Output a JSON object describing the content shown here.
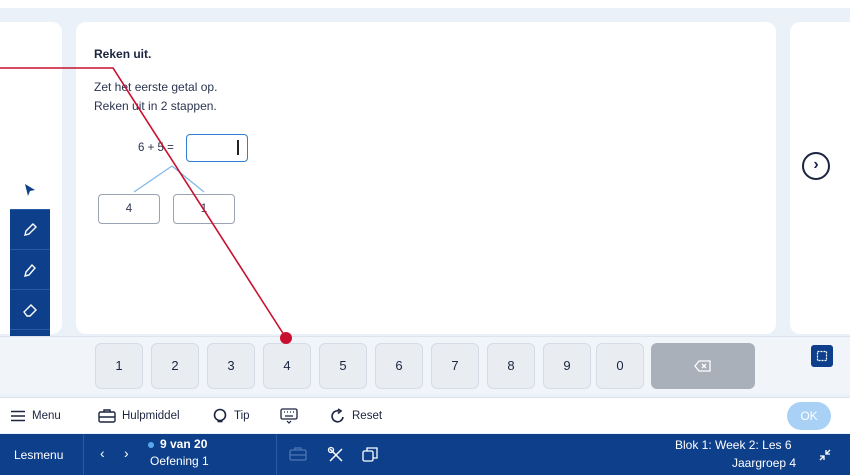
{
  "exercise": {
    "title": "Reken uit.",
    "instruction_1": "Zet het eerste getal op.",
    "instruction_2": "Reken uit in 2 stappen.",
    "expression": "6 + 5 =",
    "answer_value": "",
    "split_left": "4",
    "split_right": "1"
  },
  "tools": [
    "pointer-icon",
    "pencil-icon",
    "marker-icon",
    "eraser-icon"
  ],
  "collapse_label": "«",
  "keypad": {
    "keys": [
      "1",
      "2",
      "3",
      "4",
      "5",
      "6",
      "7",
      "8",
      "9",
      "0"
    ],
    "backspace_icon": "backspace-icon"
  },
  "menubar": {
    "menu_label": "Menu",
    "hulpmiddel_label": "Hulpmiddel",
    "tip_label": "Tip",
    "reset_label": "Reset",
    "ok_label": "OK"
  },
  "statusbar": {
    "lesmenu_label": "Lesmenu",
    "progress": "9 van 20",
    "exercise_name": "Oefening 1",
    "block_info": "Blok 1: Week 2: Les 6",
    "group_info": "Jaargroep 4"
  },
  "colors": {
    "primary": "#0d3f8a",
    "accent": "#2e7fd0",
    "annotation": "#c8102e",
    "ok_disabled": "#a9d1f5"
  }
}
